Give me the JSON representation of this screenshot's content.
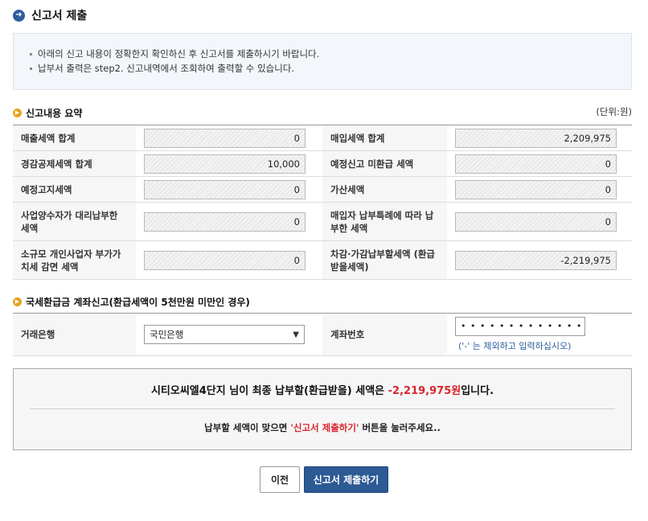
{
  "header": {
    "title": "신고서 제출",
    "icon": "arrow-right-circle-icon"
  },
  "notice": {
    "lines": [
      "아래의 신고 내용이 정확한지 확인하신 후 신고서를 제출하시기 바랍니다.",
      "납부서 출력은 step2. 신고내역에서 조회하여 출력할 수 있습니다."
    ]
  },
  "summary_section": {
    "title": "신고내용 요약",
    "unit": "(단위:원)",
    "rows": [
      {
        "left_label": "매출세액 합계",
        "left_value": "0",
        "right_label": "매입세액 합계",
        "right_value": "2,209,975"
      },
      {
        "left_label": "경감공제세액 합계",
        "left_value": "10,000",
        "right_label": "예정신고 미환급 세액",
        "right_value": "0"
      },
      {
        "left_label": "예정고지세액",
        "left_value": "0",
        "right_label": "가산세액",
        "right_value": "0"
      },
      {
        "left_label": "사업양수자가 대리납부한 세액",
        "left_value": "0",
        "right_label": "매입자 납부특례에 따라 납부한 세액",
        "right_value": "0"
      },
      {
        "left_label": "소규모 개인사업자 부가가치세 감면 세액",
        "left_value": "0",
        "right_label": "차감·가감납부할세액 (환급받을세액)",
        "right_value": "-2,219,975"
      }
    ]
  },
  "refund_section": {
    "title": "국세환급금 계좌신고(환급세액이 5천만원 미만인 경우)",
    "bank_label": "거래은행",
    "bank_selected": "국민은행",
    "account_label": "계좌번호",
    "account_value": "• • • • • • • • • • • • • • •",
    "account_hint": "('-' 는 제외하고 입력하십시오)"
  },
  "result": {
    "prefix": "시티오씨엘4단지 님이 최종 납부할(환급받을) 세액은 ",
    "amount": "-2,219,975원",
    "suffix": "입니다.",
    "sub_prefix": "납부할 세액이 맞으면 ",
    "sub_highlight": "'신고서 제출하기'",
    "sub_suffix": " 버튼을 눌러주세요.."
  },
  "buttons": {
    "prev": "이전",
    "submit": "신고서 제출하기"
  },
  "colors": {
    "accent_blue": "#2c5a95",
    "highlight_red": "#d8262d",
    "section_icon": "#e8a21c"
  }
}
